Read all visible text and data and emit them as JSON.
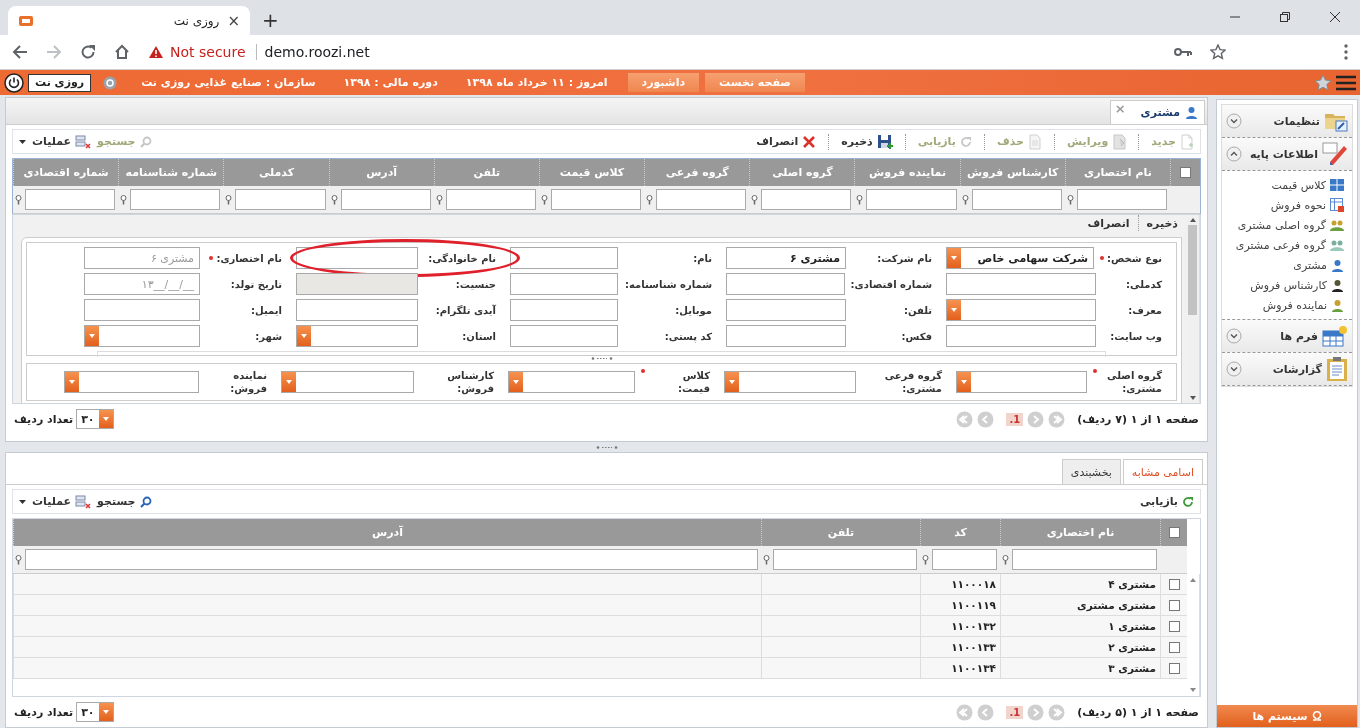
{
  "browser": {
    "tab_title": "روزی نت",
    "tab_close": "×",
    "new_tab": "+",
    "security": "Not secure",
    "url": "demo.roozi.net"
  },
  "header": {
    "buttons": [
      "صفحه نخست",
      "داشبورد"
    ],
    "info": [
      {
        "label": "امروز :",
        "value": "۱۱ خرداد ماه ۱۳۹۸"
      },
      {
        "label": "دوره مالی :",
        "value": "۱۳۹۸"
      },
      {
        "label": "سازمان :",
        "value": "صنایع غذایی روزی نت"
      }
    ],
    "user": "روزی نت"
  },
  "page_tab": {
    "label": "مشتری",
    "close": "×"
  },
  "toolbar": {
    "actions": [
      {
        "label": "جدید",
        "disabled": true
      },
      {
        "label": "ویرایش",
        "disabled": true
      },
      {
        "label": "حذف",
        "disabled": true
      },
      {
        "label": "بازیابی",
        "disabled": true
      },
      {
        "label": "ذخیره",
        "disabled": false
      },
      {
        "label": "انصراف",
        "disabled": false
      }
    ],
    "tools": [
      {
        "label": "جستجو",
        "disabled": true
      },
      {
        "label": "عملیات",
        "disabled": false
      }
    ]
  },
  "grid": {
    "select_all": false,
    "columns": [
      "نام اختصاری",
      "کارشناس فروش",
      "نماینده فروش",
      "گروه اصلی",
      "گروه فرعی",
      "کلاس قیمت",
      "تلفن",
      "آدرس",
      "کدملی",
      "شماره شناسنامه",
      "شماره اقتصادی"
    ]
  },
  "form": {
    "actions": [
      "ذخیره",
      "انصراف"
    ],
    "rows": [
      [
        {
          "label": "نوع شخص:",
          "required": true,
          "kind": "select",
          "value": "شرکت سهامی خاص"
        },
        {
          "label": "نام شرکت:",
          "kind": "text",
          "value": "مشتری ۶"
        },
        {
          "label": "نام:",
          "kind": "text"
        },
        {
          "label": "نام خانوادگی:",
          "kind": "text",
          "highlighted": true
        },
        {
          "label": "نام اختصاری:",
          "required": true,
          "kind": "text",
          "placeholder": "مشتری ۶"
        }
      ],
      [
        {
          "label": "کدملی:",
          "kind": "text"
        },
        {
          "label": "شماره اقتصادی:",
          "kind": "text"
        },
        {
          "label": "شماره شناسنامه:",
          "kind": "text"
        },
        {
          "label": "جنسیت:",
          "kind": "disabled"
        },
        {
          "label": "تاریخ تولد:",
          "kind": "text",
          "placeholder": "__/__/__۱۳"
        }
      ],
      [
        {
          "label": "معرف:",
          "kind": "select"
        },
        {
          "label": "تلفن:",
          "kind": "text"
        },
        {
          "label": "موبایل:",
          "kind": "text"
        },
        {
          "label": "آیدی تلگرام:",
          "kind": "text"
        },
        {
          "label": "ایمیل:",
          "kind": "text"
        }
      ],
      [
        {
          "label": "وب سایت:",
          "kind": "text"
        },
        {
          "label": "فکس:",
          "kind": "text"
        },
        {
          "label": "کد پستی:",
          "kind": "text"
        },
        {
          "label": "استان:",
          "kind": "select"
        },
        {
          "label": "شهر:",
          "kind": "select"
        }
      ]
    ],
    "group": [
      {
        "label": "گروه اصلی مشتری:",
        "required": true,
        "kind": "select"
      },
      {
        "label": "گروه فرعی مشتری:",
        "kind": "select"
      },
      {
        "label": "کلاس قیمت:",
        "required": true,
        "kind": "select"
      },
      {
        "label": "کارشناس فروش:",
        "kind": "select"
      },
      {
        "label": "نماینده فروش:",
        "kind": "select"
      }
    ]
  },
  "pager": {
    "summary": "صفحه ۱ از ۱ (۷ ردیف)",
    "page": "1.",
    "rows_label": "تعداد ردیف",
    "page_size": "۳۰"
  },
  "similar": {
    "tabs": [
      {
        "label": "اسامی مشابه",
        "selected": true
      },
      {
        "label": "بخشبندی",
        "selected": false
      }
    ],
    "toolbar": {
      "actions": [
        {
          "label": "بازیابی",
          "disabled": false
        }
      ],
      "tools": [
        {
          "label": "جستجو",
          "disabled": false
        },
        {
          "label": "عملیات",
          "disabled": false
        }
      ]
    },
    "select_all": false,
    "columns": [
      "نام اختصاری",
      "کد",
      "تلفن",
      "آدرس"
    ],
    "rows": [
      {
        "checked": false,
        "name": "مشتری ۴",
        "code": "۱۱۰۰۰۱۸"
      },
      {
        "checked": false,
        "name": "مشتری مشتری",
        "code": "۱۱۰۰۱۱۹"
      },
      {
        "checked": false,
        "name": "مشتری ۱",
        "code": "۱۱۰۰۱۳۲"
      },
      {
        "checked": false,
        "name": "مشتری ۲",
        "code": "۱۱۰۰۱۳۳"
      },
      {
        "checked": false,
        "name": "مشتری ۳",
        "code": "۱۱۰۰۱۳۴"
      }
    ],
    "pager": {
      "summary": "صفحه ۱ از ۱ (۵ ردیف)",
      "page": "1.",
      "rows_label": "تعداد ردیف",
      "page_size": "۳۰"
    }
  },
  "sidebar": {
    "sections": [
      {
        "label": "تنظیمات",
        "expanded": false
      },
      {
        "label": "اطلاعات پایه",
        "expanded": true,
        "children": [
          {
            "label": "کلاس قیمت"
          },
          {
            "label": "نحوه فروش"
          },
          {
            "label": "گروه اصلی مشتری"
          },
          {
            "label": "گروه فرعی مشتری"
          },
          {
            "label": "مشتری"
          },
          {
            "label": "کارشناس فروش"
          },
          {
            "label": "نماینده فروش"
          }
        ]
      },
      {
        "label": "فرم ها",
        "expanded": false
      },
      {
        "label": "گزارشات",
        "expanded": false
      }
    ],
    "systems": "سیستم ها"
  }
}
